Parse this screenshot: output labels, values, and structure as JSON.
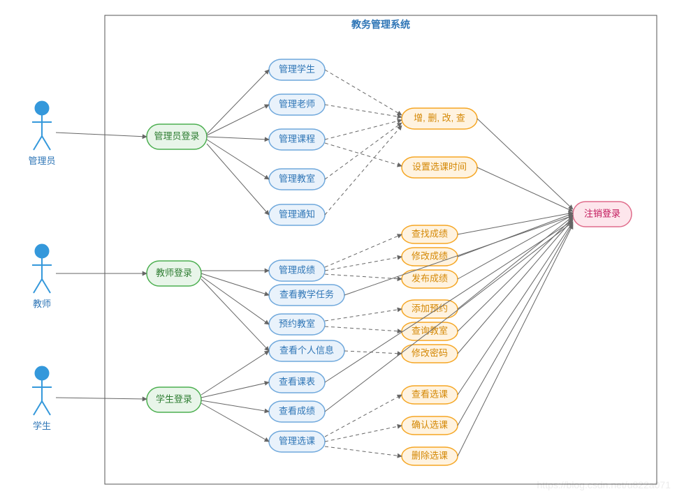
{
  "system_title": "教务管理系统",
  "actors": {
    "admin": {
      "label": "管理员"
    },
    "teacher": {
      "label": "教师"
    },
    "student": {
      "label": "学生"
    }
  },
  "logins": {
    "admin": "管理员登录",
    "teacher": "教师登录",
    "student": "学生登录"
  },
  "admin_ops": {
    "manage_student": "管理学生",
    "manage_teacher": "管理老师",
    "manage_course": "管理课程",
    "manage_room": "管理教室",
    "manage_notice": "管理通知"
  },
  "crud": "增, 删, 改, 查",
  "set_select_time": "设置选课时间",
  "teacher_ops": {
    "manage_grade": "管理成绩",
    "view_task": "查看教学任务",
    "book_room": "预约教室"
  },
  "grade_ops": {
    "search": "查找成绩",
    "modify": "修改成绩",
    "publish": "发布成绩"
  },
  "book_ops": {
    "add": "添加预约",
    "query": "查询教室"
  },
  "shared_ops": {
    "view_profile": "查看个人信息",
    "mod_pwd": "修改密码"
  },
  "student_ops": {
    "view_table": "查看课表",
    "view_grade": "查看成绩",
    "manage_select": "管理选课"
  },
  "select_ops": {
    "view": "查看选课",
    "confirm": "确认选课",
    "delete": "删除选课"
  },
  "logout": "注销登录",
  "watermark": "https://blog.csdn.net/u822a071"
}
